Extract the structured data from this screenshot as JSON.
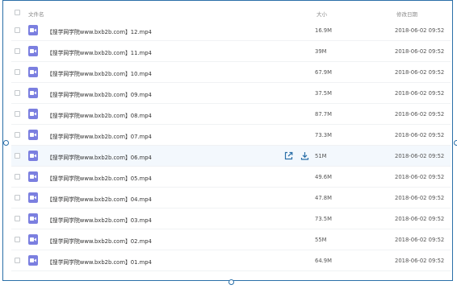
{
  "header": {
    "name_label": "文件名",
    "size_label": "大小",
    "date_label": "修改日期"
  },
  "colors": {
    "accent": "#2a6fa8",
    "video_icon": "#7b7fe0",
    "row_hover": "#f3f8fd"
  },
  "files": [
    {
      "name": "【搜学网学院www.bxb2b.com】12.mp4",
      "size": "16.9M",
      "date": "2018-06-02 09:52",
      "icon": "video-file-icon"
    },
    {
      "name": "【搜学网学院www.bxb2b.com】11.mp4",
      "size": "39M",
      "date": "2018-06-02 09:52",
      "icon": "video-file-icon"
    },
    {
      "name": "【搜学网学院www.bxb2b.com】10.mp4",
      "size": "67.9M",
      "date": "2018-06-02 09:52",
      "icon": "video-file-icon"
    },
    {
      "name": "【搜学网学院www.bxb2b.com】09.mp4",
      "size": "37.5M",
      "date": "2018-06-02 09:52",
      "icon": "video-file-icon"
    },
    {
      "name": "【搜学网学院www.bxb2b.com】08.mp4",
      "size": "87.7M",
      "date": "2018-06-02 09:52",
      "icon": "video-file-icon"
    },
    {
      "name": "【搜学网学院www.bxb2b.com】07.mp4",
      "size": "73.3M",
      "date": "2018-06-02 09:52",
      "icon": "video-file-icon"
    },
    {
      "name": "【搜学网学院www.bxb2b.com】06.mp4",
      "size": "51M",
      "date": "2018-06-02 09:52",
      "icon": "video-file-icon",
      "hovered": true
    },
    {
      "name": "【搜学网学院www.bxb2b.com】05.mp4",
      "size": "49.6M",
      "date": "2018-06-02 09:52",
      "icon": "video-file-icon"
    },
    {
      "name": "【搜学网学院www.bxb2b.com】04.mp4",
      "size": "47.8M",
      "date": "2018-06-02 09:52",
      "icon": "video-file-icon"
    },
    {
      "name": "【搜学网学院www.bxb2b.com】03.mp4",
      "size": "73.5M",
      "date": "2018-06-02 09:52",
      "icon": "video-file-icon"
    },
    {
      "name": "【搜学网学院www.bxb2b.com】02.mp4",
      "size": "55M",
      "date": "2018-06-02 09:52",
      "icon": "video-file-icon"
    },
    {
      "name": "【搜学网学院www.bxb2b.com】01.mp4",
      "size": "64.9M",
      "date": "2018-06-02 09:52",
      "icon": "video-file-icon"
    }
  ],
  "row_actions": [
    {
      "icon": "share-icon"
    },
    {
      "icon": "download-icon"
    }
  ]
}
